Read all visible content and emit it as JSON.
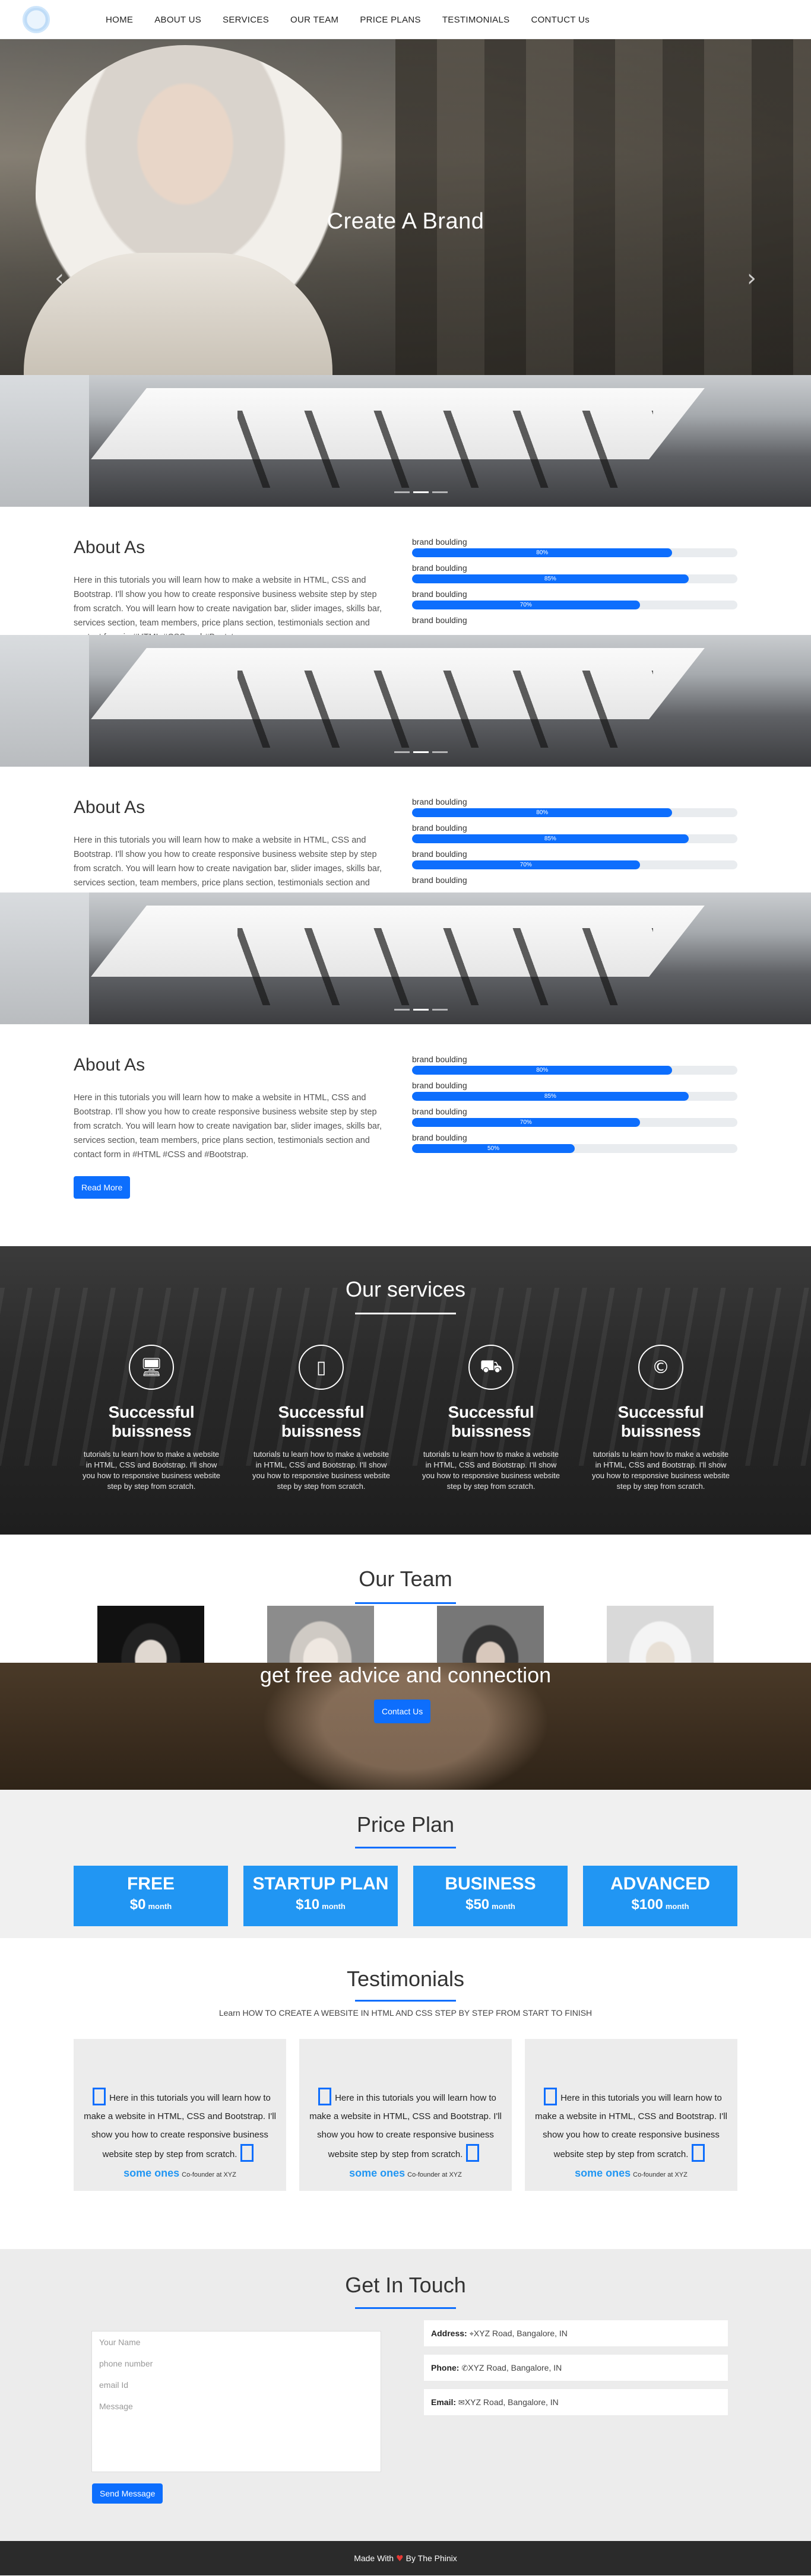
{
  "nav": {
    "items": [
      "HOME",
      "ABOUT US",
      "SERVICES",
      "OUR TEAM",
      "PRICE PLANS",
      "TESTIMONIALS",
      "CONTUCT Us"
    ]
  },
  "hero": {
    "title": "Create A Brand",
    "prev_icon": "chevron-left-icon",
    "next_icon": "chevron-right-icon"
  },
  "about": {
    "title": "About As",
    "text": "Here in this tutorials you will learn how to make a website in HTML, CSS and Bootstrap. I'll show you how to create responsive business website step by step from scratch. You will learn how to create navigation bar, slider images, skills bar, services section, team members, price plans section, testimonials section and contact form in #HTML #CSS and #Bootstrap.",
    "button": "Read More",
    "skills": [
      {
        "label": "brand boulding",
        "percent": 80,
        "text": "80%"
      },
      {
        "label": "brand boulding",
        "percent": 85,
        "text": "85%"
      },
      {
        "label": "brand boulding",
        "percent": 70,
        "text": "70%"
      },
      {
        "label": "brand boulding",
        "percent": 50,
        "text": "50%"
      }
    ]
  },
  "services": {
    "title": "Our services",
    "items": [
      {
        "icon": "monitor-icon",
        "glyph": "🖥",
        "title": "Successful buissness",
        "text": "tutorials tu learn how to make a website in HTML, CSS and Bootstrap. I'll show you how to responsive business website step by step from scratch."
      },
      {
        "icon": "tablet-icon",
        "glyph": "▯",
        "title": "Successful buissness",
        "text": "tutorials tu learn how to make a website in HTML, CSS and Bootstrap. I'll show you how to responsive business website step by step from scratch."
      },
      {
        "icon": "car-icon",
        "glyph": "⛟",
        "title": "Successful buissness",
        "text": "tutorials tu learn how to make a website in HTML, CSS and Bootstrap. I'll show you how to responsive business website step by step from scratch."
      },
      {
        "icon": "copyright-icon",
        "glyph": "©",
        "title": "Successful buissness",
        "text": "tutorials tu learn how to make a website in HTML, CSS and Bootstrap. I'll show you how to responsive business website step by step from scratch."
      }
    ]
  },
  "team": {
    "title": "Our Team"
  },
  "advice": {
    "text": "get free advice and connection",
    "button": "Contact Us"
  },
  "price": {
    "title": "Price Plan",
    "plans": [
      {
        "name": "FREE",
        "amount": "$0",
        "period": "month"
      },
      {
        "name": "STARTUP PLAN",
        "amount": "$10",
        "period": "month"
      },
      {
        "name": "BUSINESS",
        "amount": "$50",
        "period": "month"
      },
      {
        "name": "ADVANCED",
        "amount": "$100",
        "period": "month"
      }
    ]
  },
  "testimonials": {
    "title": "Testimonials",
    "subtitle": "Learn HOW TO CREATE A WEBSITE IN HTML AND CSS STEP BY STEP FROM START TO FINISH",
    "items": [
      {
        "text": "Here in this tutorials you will learn how to make a website in HTML, CSS and Bootstrap. I'll show you how to create responsive business website step by step from scratch.",
        "name": "some ones",
        "role": "Co-founder at XYZ"
      },
      {
        "text": "Here in this tutorials you will learn how to make a website in HTML, CSS and Bootstrap. I'll show you how to create responsive business website step by step from scratch.",
        "name": "some ones",
        "role": "Co-founder at XYZ"
      },
      {
        "text": "Here in this tutorials you will learn how to make a website in HTML, CSS and Bootstrap. I'll show you how to create responsive business website step by step from scratch.",
        "name": "some ones",
        "role": "Co-founder at XYZ"
      }
    ]
  },
  "contact": {
    "title": "Get In Touch",
    "placeholders": {
      "name": "Your Name",
      "phone": "phone number",
      "email": "email Id",
      "message": "Message"
    },
    "button": "Send Message",
    "address_label": "Address:",
    "address": "XYZ Road, Bangalore, IN",
    "phone_label": "Phone:",
    "phone": "XYZ Road, Bangalore, IN",
    "email_label": "Email:",
    "email": "XYZ Road, Bangalore, IN"
  },
  "footer": {
    "prefix": "Made With",
    "suffix": "By The Phinix"
  },
  "colors": {
    "primary": "#0d6efd",
    "plan": "#2196f3"
  }
}
